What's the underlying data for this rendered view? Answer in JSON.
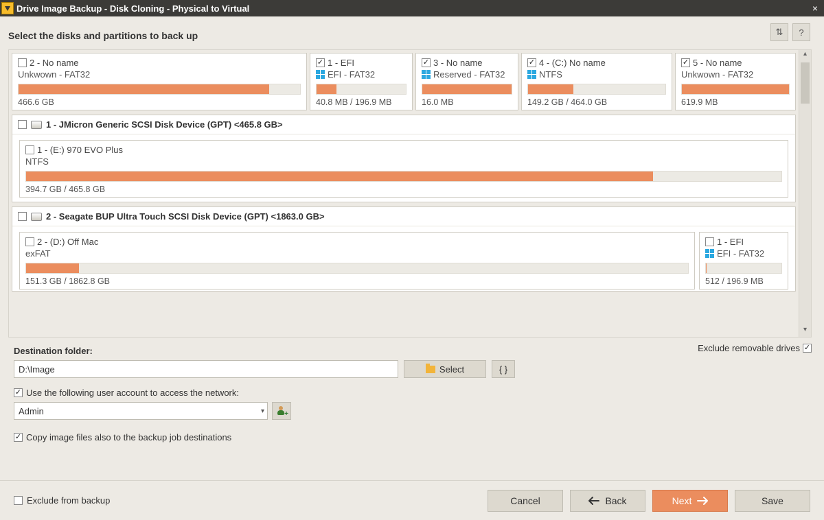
{
  "window": {
    "title": "Drive Image Backup - Disk Cloning - Physical to Virtual",
    "close_glyph": "×"
  },
  "header": {
    "instruction": "Select the disks and partitions to back up",
    "refresh_icon": "⇅",
    "help_icon": "?"
  },
  "top_row": {
    "p1": {
      "title": "2 -  No name",
      "fs": "Unkwown - FAT32",
      "size": "466.6 GB",
      "checked": false,
      "fill_pct": 89,
      "win": false
    },
    "p2": {
      "title": "1 -  EFI",
      "fs": "EFI - FAT32",
      "size": "40.8 MB / 196.9 MB",
      "checked": true,
      "fill_pct": 22,
      "win": true
    },
    "p3": {
      "title": "3 -  No name",
      "fs": "Reserved - FAT32",
      "size": "16.0 MB",
      "checked": true,
      "fill_pct": 100,
      "win": true
    },
    "p4": {
      "title": "4 - (C:) No name",
      "fs": "NTFS",
      "size": "149.2 GB / 464.0 GB",
      "checked": true,
      "fill_pct": 33,
      "win": true
    },
    "p5": {
      "title": "5 -  No name",
      "fs": "Unkwown - FAT32",
      "size": "619.9 MB",
      "checked": true,
      "fill_pct": 100,
      "win": false
    }
  },
  "disk1": {
    "label": "1 - JMicron Generic SCSI Disk Device (GPT) <465.8 GB>",
    "p": {
      "title": "1 - (E:) 970 EVO Plus",
      "fs": "NTFS",
      "size": "394.7 GB / 465.8 GB",
      "checked": false,
      "fill_pct": 83
    }
  },
  "disk2": {
    "label": "2 - Seagate BUP Ultra Touch SCSI Disk Device (GPT) <1863.0 GB>",
    "p1": {
      "title": "2 - (D:) Off Mac",
      "fs": "exFAT",
      "size": "151.3 GB / 1862.8 GB",
      "checked": false,
      "fill_pct": 8
    },
    "p2": {
      "title": "1 -  EFI",
      "fs": "EFI - FAT32",
      "size": "512 / 196.9 MB",
      "checked": false,
      "fill_pct": 1,
      "win": true
    }
  },
  "options": {
    "exclude_removable_label": "Exclude removable drives",
    "exclude_removable_checked": true,
    "destination_label": "Destination folder:",
    "destination_value": "D:\\Image",
    "select_label": "Select",
    "braces_label": "{ }",
    "use_account_label": "Use the following user account to access the network:",
    "use_account_checked": true,
    "account_value": "Admin",
    "copy_images_label": "Copy image files also to the backup job destinations",
    "copy_images_checked": true
  },
  "footer": {
    "exclude_backup_label": "Exclude from backup",
    "exclude_backup_checked": false,
    "cancel": "Cancel",
    "back": "Back",
    "next": "Next",
    "save": "Save"
  }
}
